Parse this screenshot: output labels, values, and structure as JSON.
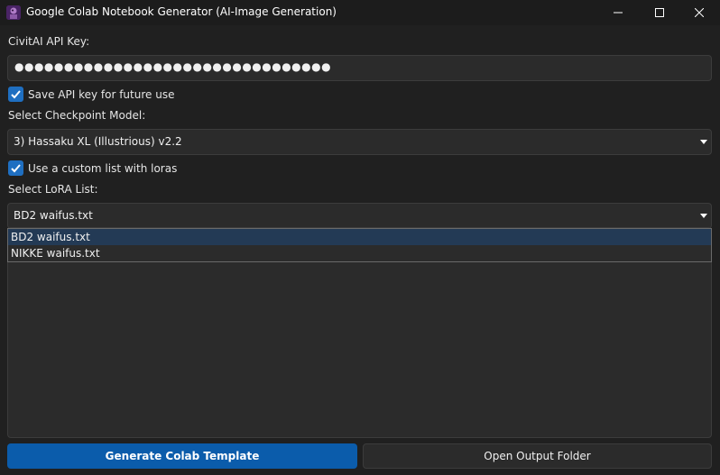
{
  "window": {
    "title": "Google Colab Notebook Generator (AI-Image Generation)",
    "controls": {
      "minimize": "minimize-icon",
      "maximize": "maximize-icon",
      "close": "close-icon"
    }
  },
  "api_key": {
    "label": "CivitAI API Key:",
    "masked_value": "●●●●●●●●●●●●●●●●●●●●●●●●●●●●●●●●"
  },
  "save_key": {
    "label": "Save API key for future use",
    "checked": true
  },
  "checkpoint": {
    "label": "Select Checkpoint Model:",
    "selected": "3) Hassaku XL (Illustrious) v2.2"
  },
  "custom_list": {
    "label": "Use a custom list with loras",
    "checked": true
  },
  "lora": {
    "label": "Select LoRA List:",
    "selected": "BD2 waifus.txt",
    "options": [
      "BD2 waifus.txt",
      "NIKKE waifus.txt"
    ]
  },
  "buttons": {
    "generate": "Generate Colab Template",
    "open_folder": "Open Output Folder"
  },
  "colors": {
    "accent": "#0b5cab",
    "checkbox": "#1f6fc1",
    "selected_option": "#233a55",
    "background": "#202020"
  }
}
